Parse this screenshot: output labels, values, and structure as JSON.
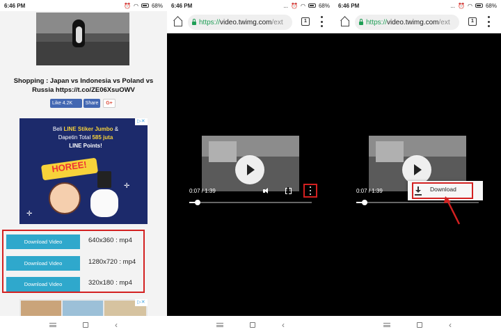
{
  "status": {
    "time": "6:46 PM",
    "battery": "68%",
    "signal_dots": "..."
  },
  "panel1": {
    "title": "Shopping : Japan vs Indonesia vs Poland vs Russia https://t.co/ZE06XsuOWV",
    "fb_like": "Like 4.2K",
    "fb_share": "Share",
    "gplus": "G+",
    "ad1": {
      "line1_a": "Beli ",
      "line1_b": "LINE Stiker Jumbo",
      "line1_c": " &",
      "line2_a": "Dapetin Total ",
      "line2_b": "585 juta",
      "line3": "LINE Points!",
      "badge": "HOREE!"
    },
    "downloads": [
      {
        "label": "Download Video",
        "format": "640x360 : mp4"
      },
      {
        "label": "Download Video",
        "format": "1280x720 : mp4"
      },
      {
        "label": "Download Video",
        "format": "320x180 : mp4"
      }
    ]
  },
  "browser": {
    "scheme": "https://",
    "host": "video.twimg.com",
    "path": "/ext",
    "tab_count": "1"
  },
  "player": {
    "current": "0:07",
    "duration": "1:39",
    "time_text": "0:07 / 1:39",
    "progress_fraction": 0.07
  },
  "menu": {
    "download_label": "Download"
  },
  "colors": {
    "highlight": "#d32020",
    "download_button": "#2fa8cc",
    "secure": "#1e9e55"
  }
}
